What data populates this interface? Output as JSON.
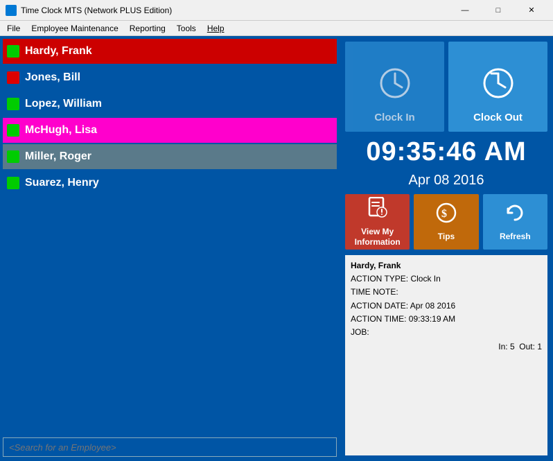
{
  "titlebar": {
    "title": "Time Clock MTS (Network PLUS Edition)",
    "icon": "clock-icon"
  },
  "menu": {
    "items": [
      "File",
      "Employee Maintenance",
      "Reporting",
      "Tools",
      "Help"
    ]
  },
  "employees": [
    {
      "name": "Hardy, Frank",
      "status": "green",
      "style": "highlighted"
    },
    {
      "name": "Jones, Bill",
      "status": "red",
      "style": "normal"
    },
    {
      "name": "Lopez, William",
      "status": "green",
      "style": "normal"
    },
    {
      "name": "McHugh, Lisa",
      "status": "green",
      "style": "selected"
    },
    {
      "name": "Miller, Roger",
      "status": "green",
      "style": "hovered"
    },
    {
      "name": "Suarez, Henry",
      "status": "green",
      "style": "normal"
    }
  ],
  "search": {
    "placeholder": "<Search for an Employee>"
  },
  "actions": {
    "clock_in": "Clock In",
    "clock_out": "Clock Out"
  },
  "clock": {
    "time": "09:35:46 AM",
    "date": "Apr 08 2016"
  },
  "bottom_buttons": {
    "view_info": "View My\nInformation",
    "tips": "Tips",
    "refresh": "Refresh"
  },
  "last_action": {
    "employee": "Hardy, Frank",
    "action_type": "Clock In",
    "time_note": "",
    "action_date": "Apr 08 2016",
    "action_time": "09:33:19 AM",
    "job": "",
    "in_count": "5",
    "out_count": "1"
  },
  "status_colors": {
    "green": "#00cc00",
    "red": "#dd0000",
    "magenta": "#ff00cc"
  }
}
